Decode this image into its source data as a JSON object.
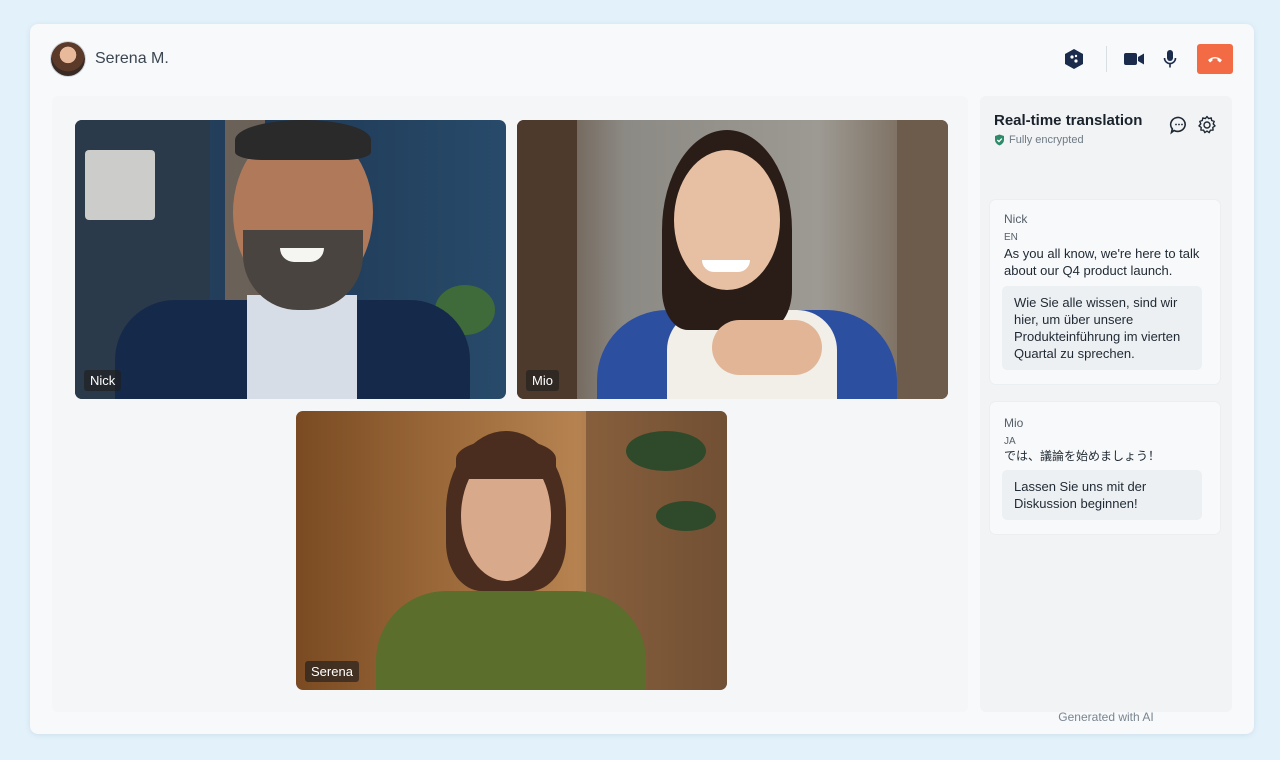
{
  "header": {
    "user_name": "Serena M.",
    "icons": [
      "app-logo-icon",
      "camera-icon",
      "microphone-icon",
      "end-call-icon"
    ],
    "end_call_color": "#f26b45"
  },
  "participants": [
    {
      "name": "Nick"
    },
    {
      "name": "Mio"
    },
    {
      "name": "Serena"
    }
  ],
  "panel": {
    "title": "Real-time translation",
    "encryption": "Fully encrypted",
    "icons": [
      "chat-icon",
      "gear-icon"
    ],
    "messages": [
      {
        "speaker": "Nick",
        "lang": "EN",
        "original": "As you all know, we're here to talk about our Q4 product launch.",
        "translation": "Wie Sie alle wissen, sind wir hier, um über unsere Produkteinführung im vierten Quartal zu sprechen."
      },
      {
        "speaker": "Mio",
        "lang": "JA",
        "original": "では、議論を始めましょう！",
        "translation": "Lassen Sie uns mit der Diskussion beginnen!"
      }
    ],
    "footer": "Generated with AI"
  }
}
